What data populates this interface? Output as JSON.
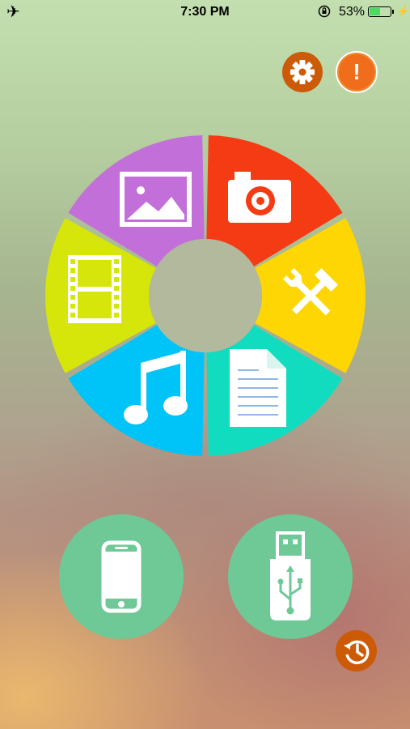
{
  "status_bar": {
    "airplane_icon": "airplane-icon",
    "time": "7:30 PM",
    "orientation_lock_icon": "orientation-lock-icon",
    "battery_percent": "53%",
    "battery_level": 0.53,
    "charging_icon": "bolt-icon"
  },
  "top_actions": [
    {
      "icon": "gear-icon",
      "color": "#cc5a06"
    },
    {
      "icon": "exclamation-icon",
      "glyph": "!",
      "color": "#f06d1c"
    }
  ],
  "wheel": {
    "segments": [
      {
        "name": "camera",
        "icon": "camera-icon",
        "color": "#f53b13"
      },
      {
        "name": "tools",
        "icon": "tools-icon",
        "color": "#fdd604"
      },
      {
        "name": "documents",
        "icon": "document-icon",
        "color": "#12dcc0"
      },
      {
        "name": "music",
        "icon": "music-note-icon",
        "color": "#00c4f8"
      },
      {
        "name": "videos",
        "icon": "film-icon",
        "color": "#d6e60a"
      },
      {
        "name": "photos",
        "icon": "image-icon",
        "color": "#c36fd9"
      }
    ],
    "center_color": "#b3b99d"
  },
  "bottom_actions": [
    {
      "icon": "smartphone-icon",
      "color": "#6ec996"
    },
    {
      "icon": "usb-drive-icon",
      "color": "#6ec996"
    }
  ],
  "history_button": {
    "icon": "history-icon",
    "color": "#cc5a06"
  }
}
